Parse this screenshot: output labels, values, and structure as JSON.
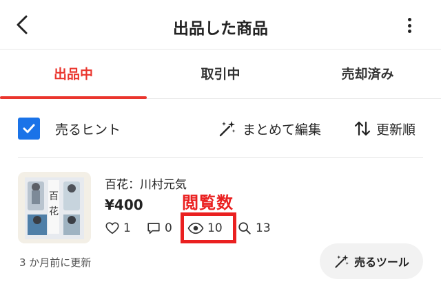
{
  "header": {
    "title": "出品した商品"
  },
  "tabs": [
    {
      "label": "出品中",
      "active": true
    },
    {
      "label": "取引中",
      "active": false
    },
    {
      "label": "売却済み",
      "active": false
    }
  ],
  "toolbar": {
    "hint_checkbox_checked": true,
    "hint_label": "売るヒント",
    "bulk_edit_label": "まとめて編集",
    "sort_label": "更新順"
  },
  "item": {
    "title": "百花：川村元気",
    "price": "¥400",
    "likes": "1",
    "comments": "0",
    "views": "10",
    "searches": "13",
    "updated": "3 か月前に更新",
    "sell_tools_label": "売るツール"
  },
  "annotation": {
    "label": "閲覧数"
  },
  "colors": {
    "accent": "#ea352d",
    "checkbox": "#1a73e8",
    "annotation": "#ea2020"
  }
}
